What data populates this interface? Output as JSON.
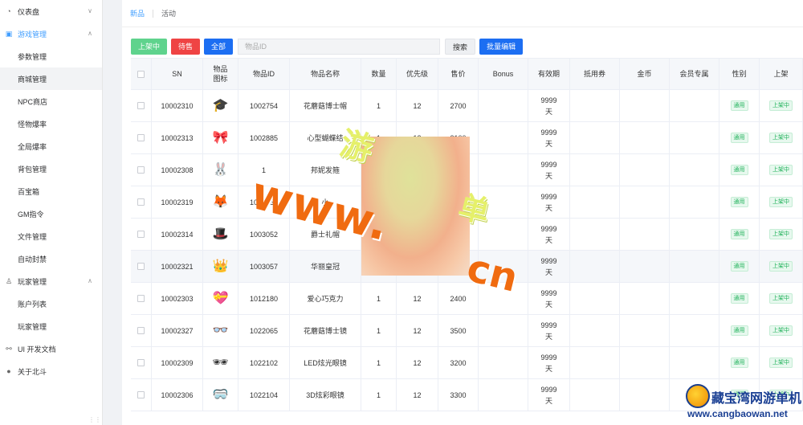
{
  "sidebar": {
    "items": [
      {
        "label": "仪表盘",
        "icon": "dashboard-icon",
        "kind": "group",
        "chevron": "∨"
      },
      {
        "label": "游戏管理",
        "icon": "game-icon",
        "kind": "group-open",
        "chevron": "∧"
      },
      {
        "label": "参数管理",
        "kind": "sub"
      },
      {
        "label": "商城管理",
        "kind": "sub-active"
      },
      {
        "label": "NPC商店",
        "kind": "sub"
      },
      {
        "label": "怪物爆率",
        "kind": "sub"
      },
      {
        "label": "全局爆率",
        "kind": "sub"
      },
      {
        "label": "背包管理",
        "kind": "sub"
      },
      {
        "label": "百宝箱",
        "kind": "sub"
      },
      {
        "label": "GM指令",
        "kind": "sub"
      },
      {
        "label": "文件管理",
        "kind": "sub"
      },
      {
        "label": "自动封禁",
        "kind": "sub"
      },
      {
        "label": "玩家管理",
        "icon": "user-icon",
        "kind": "group",
        "chevron": "∧"
      },
      {
        "label": "账户列表",
        "kind": "sub"
      },
      {
        "label": "玩家管理",
        "kind": "sub"
      },
      {
        "label": "UI 开发文档",
        "icon": "link-icon",
        "kind": "group"
      },
      {
        "label": "关于北斗",
        "icon": "github-icon",
        "kind": "group"
      }
    ]
  },
  "tabs": [
    {
      "label": "新品",
      "active": true
    },
    {
      "label": "活动",
      "active": false
    }
  ],
  "toolbar": {
    "on_shelf": "上架中",
    "pending": "待售",
    "all": "全部",
    "search_placeholder": "物品ID",
    "search_btn": "搜索",
    "batch_edit": "批量编辑"
  },
  "table": {
    "headers": [
      "SN",
      "物品\n图标",
      "物品ID",
      "物品名称",
      "数量",
      "优先级",
      "售价",
      "Bonus",
      "有效期",
      "抵用券",
      "金币",
      "会员专属",
      "性别",
      "上架"
    ],
    "rows": [
      {
        "sn": "10002310",
        "icon": "🎓",
        "id": "1002754",
        "name": "花蘑菇博士帽",
        "qty": "1",
        "prio": "12",
        "price": "2700",
        "bonus": "",
        "valid": "9999\n天",
        "voucher": "",
        "gold": "",
        "vip": "",
        "gender": "通用",
        "shelf": "上架中"
      },
      {
        "sn": "10002313",
        "icon": "🎀",
        "id": "1002885",
        "name": "心型蝴蝶结",
        "qty": "1",
        "prio": "12",
        "price": "3100",
        "bonus": "",
        "valid": "9999\n天",
        "voucher": "",
        "gold": "",
        "vip": "",
        "gender": "通用",
        "shelf": "上架中"
      },
      {
        "sn": "10002308",
        "icon": "🐰",
        "id": "1",
        "name": "邦妮发箍",
        "qty": "",
        "prio": "",
        "price": "",
        "bonus": "",
        "valid": "9999\n天",
        "voucher": "",
        "gold": "",
        "vip": "",
        "gender": "通用",
        "shelf": "上架中"
      },
      {
        "sn": "10002319",
        "icon": "🦊",
        "id": "1003051",
        "name": "小",
        "qty": "",
        "prio": "",
        "price": "",
        "bonus": "",
        "valid": "9999\n天",
        "voucher": "",
        "gold": "",
        "vip": "",
        "gender": "通用",
        "shelf": "上架中"
      },
      {
        "sn": "10002314",
        "icon": "🎩",
        "id": "1003052",
        "name": "爵士礼帽",
        "qty": "",
        "prio": "",
        "price": "",
        "bonus": "",
        "valid": "9999\n天",
        "voucher": "",
        "gold": "",
        "vip": "",
        "gender": "通用",
        "shelf": "上架中"
      },
      {
        "sn": "10002321",
        "icon": "👑",
        "id": "1003057",
        "name": "华丽皇冠",
        "qty": "",
        "prio": "",
        "price": "",
        "bonus": "",
        "valid": "9999\n天",
        "voucher": "",
        "gold": "",
        "vip": "",
        "gender": "通用",
        "shelf": "上架中"
      },
      {
        "sn": "10002303",
        "icon": "💝",
        "id": "1012180",
        "name": "爱心巧克力",
        "qty": "1",
        "prio": "12",
        "price": "2400",
        "bonus": "",
        "valid": "9999\n天",
        "voucher": "",
        "gold": "",
        "vip": "",
        "gender": "通用",
        "shelf": "上架中"
      },
      {
        "sn": "10002327",
        "icon": "👓",
        "id": "1022065",
        "name": "花蘑菇博士镜",
        "qty": "1",
        "prio": "12",
        "price": "3500",
        "bonus": "",
        "valid": "9999\n天",
        "voucher": "",
        "gold": "",
        "vip": "",
        "gender": "通用",
        "shelf": "上架中"
      },
      {
        "sn": "10002309",
        "icon": "🕶",
        "id": "1022102",
        "name": "LED炫光眼镜",
        "qty": "1",
        "prio": "12",
        "price": "3200",
        "bonus": "",
        "valid": "9999\n天",
        "voucher": "",
        "gold": "",
        "vip": "",
        "gender": "通用",
        "shelf": "上架中"
      },
      {
        "sn": "10002306",
        "icon": "🥽",
        "id": "1022104",
        "name": "3D炫彩眼镜",
        "qty": "1",
        "prio": "12",
        "price": "3300",
        "bonus": "",
        "valid": "9999\n天",
        "voucher": "",
        "gold": "",
        "vip": "",
        "gender": "通用",
        "shelf": "上架中"
      }
    ]
  },
  "watermark": {
    "line1": "游",
    "line2": "www.",
    "line3": "单",
    "line4": "cn"
  },
  "logo": {
    "title": "藏宝湾网游单机",
    "url": "www.cangbaowan.net"
  }
}
